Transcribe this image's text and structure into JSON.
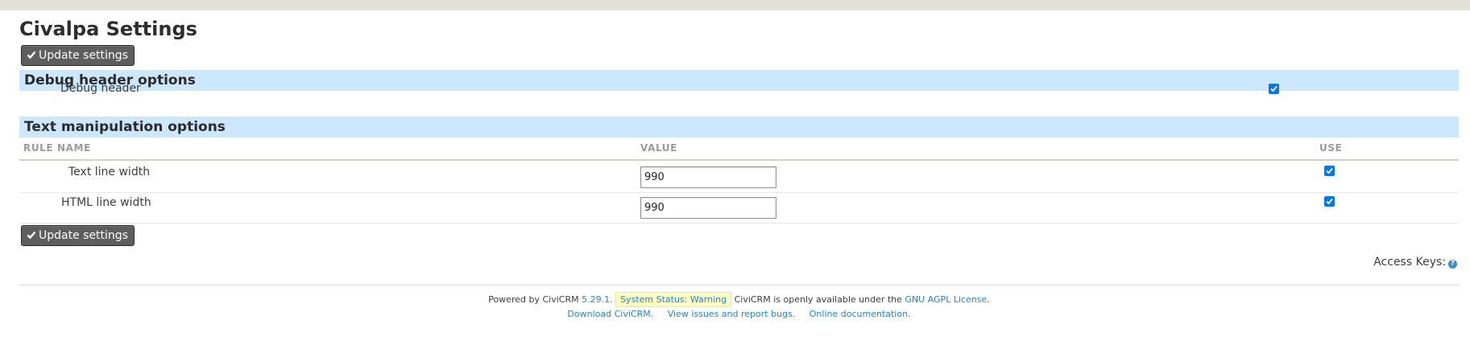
{
  "page": {
    "title": "Civalpa Settings"
  },
  "buttons": {
    "update_top": "Update settings",
    "update_bottom": "Update settings"
  },
  "sections": {
    "debug": {
      "header": "Debug header options",
      "row_label": "Debug header",
      "checked": true
    },
    "text": {
      "header": "Text manipulation options",
      "columns": [
        "RULE NAME",
        "VALUE",
        "USE"
      ],
      "rows": [
        {
          "label": "Text line width",
          "value": "990",
          "use": true
        },
        {
          "label": "HTML line width",
          "value": "990",
          "use": true
        }
      ]
    }
  },
  "access_keys": {
    "label": "Access Keys:",
    "icon": "question-circle-icon"
  },
  "footer": {
    "powered_by": "Powered by CiviCRM",
    "version": "5.29.1",
    "period": ".",
    "status": "System Status: Warning",
    "available_text": "CiviCRM is openly available under the",
    "license": "GNU AGPL License",
    "license_end": ".",
    "links": [
      "Download CiviCRM.",
      "View issues and report bugs.",
      "Online documentation."
    ]
  },
  "colors": {
    "accent_link": "#2786c2",
    "section_bg": "#cde8fe",
    "button_bg": "#5e5e5e",
    "checkbox": "#0b75e2",
    "warning_bg": "#ffffc1"
  }
}
